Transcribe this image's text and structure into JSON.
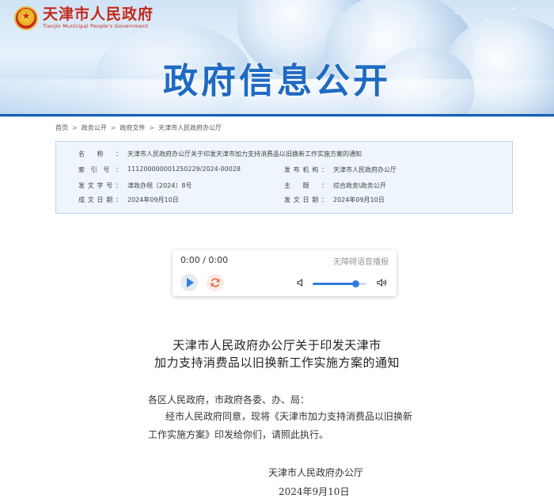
{
  "site": {
    "name_cn": "天津市人民政府",
    "name_en": "Tianjin Municipal People's Government",
    "banner_title": "政府信息公开"
  },
  "breadcrumb": [
    "首页",
    "政务公开",
    "政府文件",
    "天津市人民政府办公厅"
  ],
  "info": {
    "name_label": "名称：",
    "name_value": "天津市人民政府办公厅关于印发天津市加力支持消费品以旧换新工作实施方案的通知",
    "index_label": "索引号：",
    "index_value": "111200000001250229/2024-00028",
    "issuer_label": "发布机构：",
    "issuer_value": "天津市人民政府办公厅",
    "docno_label": "发文字号：",
    "docno_value": "津政办规〔2024〕8号",
    "topic_label": "主题：",
    "topic_value": "综合政务\\政务公开",
    "created_label": "成文日期：",
    "created_value": "2024年09月10日",
    "published_label": "发文日期：",
    "published_value": "2024年09月10日"
  },
  "player": {
    "time": "0:00 / 0:00",
    "accessible_label": "无障碍语音播报",
    "volume": 0.8
  },
  "article": {
    "title_line1": "天津市人民政府办公厅关于印发天津市",
    "title_line2": "加力支持消费品以旧换新工作实施方案的通知",
    "para1": "各区人民政府，市政府各委、办、局：",
    "para2": "经市人民政府同意，现将《天津市加力支持消费品以旧换新",
    "para3": "工作实施方案》印发给你们，请照此执行。",
    "signature": "天津市人民政府办公厅",
    "date": "2024年9月10日"
  },
  "colors": {
    "brand_red": "#c4291c",
    "title_blue": "#1f6bc2",
    "accent_blue": "#2f7de1"
  }
}
